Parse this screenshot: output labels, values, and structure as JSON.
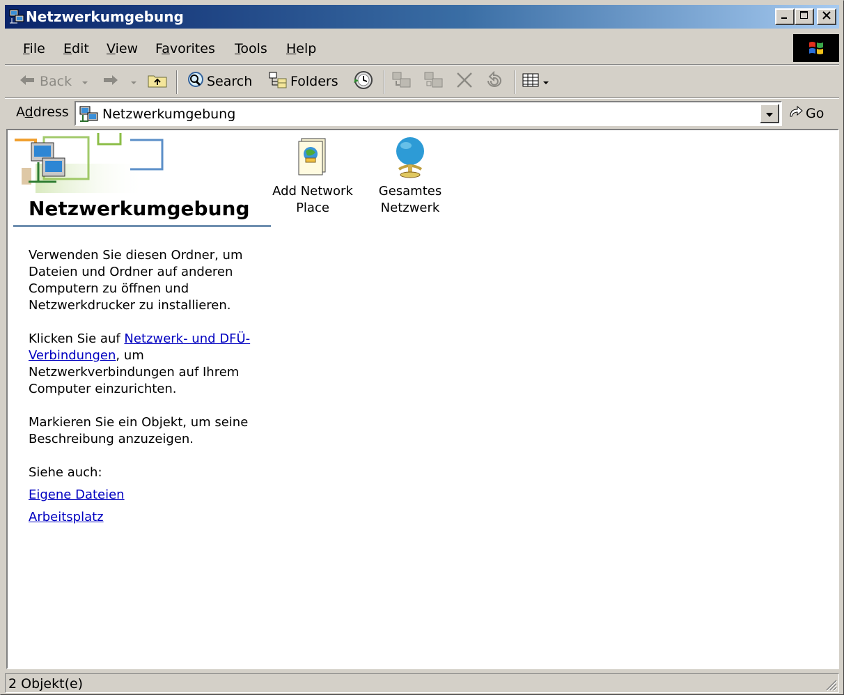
{
  "window": {
    "title": "Netzwerkumgebung",
    "caption_buttons": [
      "_",
      "□",
      "✕"
    ]
  },
  "menu": {
    "items": [
      {
        "label": "File",
        "mnemonic": "F",
        "rest": "ile"
      },
      {
        "label": "Edit",
        "mnemonic": "E",
        "rest": "dit"
      },
      {
        "label": "View",
        "mnemonic": "V",
        "rest": "iew"
      },
      {
        "label": "Favorites",
        "pre": "F",
        "mnemonic": "a",
        "rest": "vorites"
      },
      {
        "label": "Tools",
        "mnemonic": "T",
        "rest": "ools"
      },
      {
        "label": "Help",
        "mnemonic": "H",
        "rest": "elp"
      }
    ]
  },
  "toolbar": {
    "back_label": "Back",
    "search_label": "Search",
    "folders_label": "Folders",
    "icons": [
      "back-arrow-icon",
      "forward-arrow-icon",
      "up-folder-icon",
      "search-icon",
      "folders-icon",
      "history-icon",
      "move-to-icon",
      "copy-to-icon",
      "delete-icon",
      "undo-icon",
      "views-icon"
    ]
  },
  "address": {
    "label_pre": "A",
    "label_mnemonic": "d",
    "label_rest": "dress",
    "value": "Netzwerkumgebung",
    "go_label": "Go"
  },
  "leftpane": {
    "folder_title": "Netzwerkumgebung",
    "p1": "Verwenden Sie diesen Ordner, um Dateien und Ordner auf anderen Computern zu öffnen und Netzwerkdrucker zu installieren.",
    "p2_pre": "Klicken Sie auf ",
    "p2_link": "Netzwerk- und DFÜ-Verbindungen",
    "p2_post": ", um Netzwerkverbindungen auf Ihrem Computer einzurichten.",
    "p3": "Markieren Sie ein Objekt, um seine Beschreibung anzuzeigen.",
    "see_also": "Siehe auch:",
    "link1": "Eigene Dateien",
    "link2": "Arbeitsplatz"
  },
  "items": [
    {
      "label": "Add Network Place",
      "icon": "add-network-place-icon"
    },
    {
      "label": "Gesamtes Netzwerk",
      "icon": "globe-icon"
    }
  ],
  "statusbar": {
    "text": "2 Objekt(e)"
  }
}
